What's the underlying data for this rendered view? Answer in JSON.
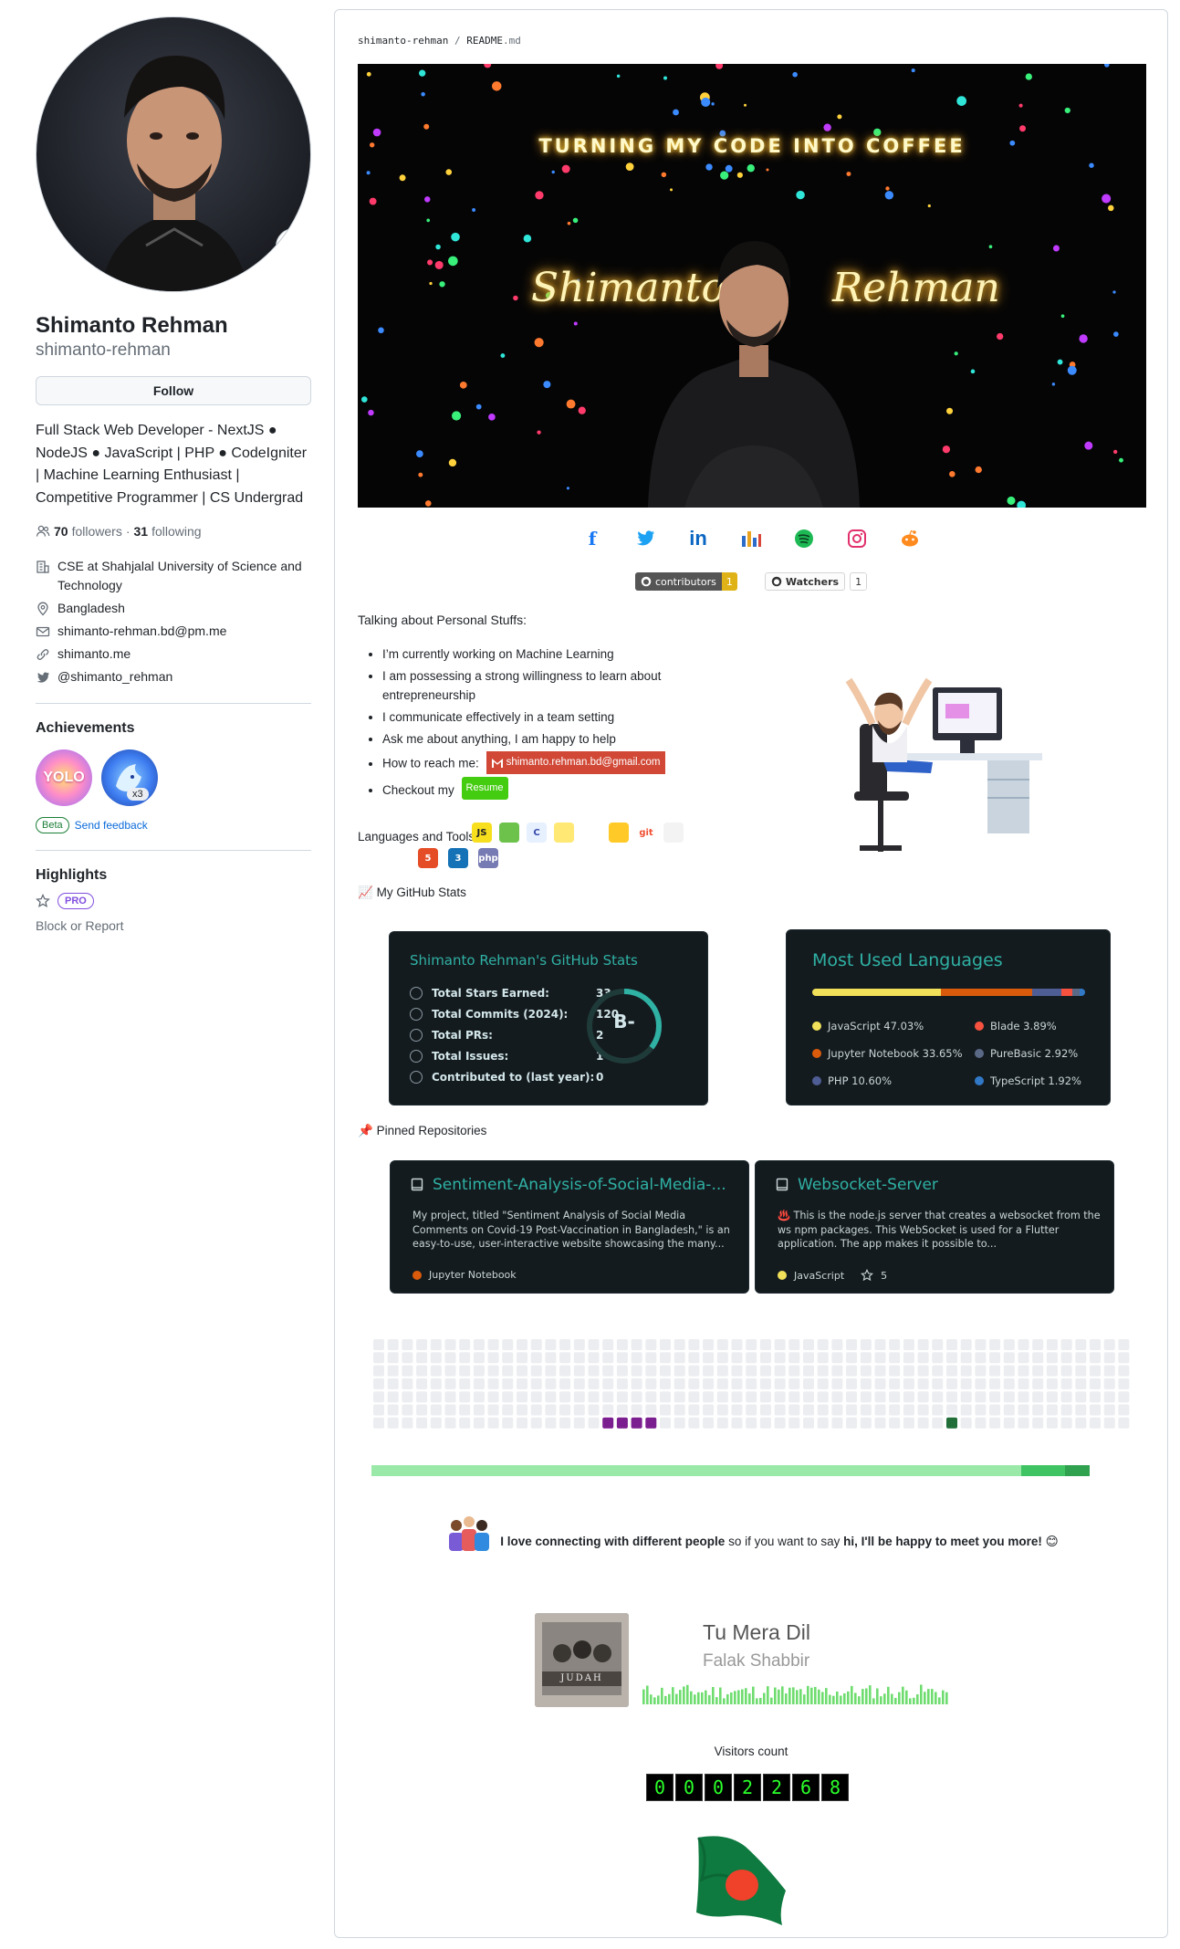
{
  "profile": {
    "display_name": "Shimanto Rehman",
    "login": "shimanto-rehman",
    "follow_label": "Follow",
    "bio": "Full Stack Web Developer - NextJS ● NodeJS ● JavaScript | PHP ● CodeIgniter | Machine Learning Enthusiast | Competitive Programmer | CS Undergrad",
    "followers_count": "70",
    "followers_label": "followers",
    "separator": "·",
    "following_count": "31",
    "following_label": "following",
    "org": "CSE at Shahjalal University of Science and Technology",
    "location": "Bangladesh",
    "email": "shimanto-rehman.bd@pm.me",
    "website": "shimanto.me",
    "twitter": "@shimanto_rehman"
  },
  "achievements": {
    "title": "Achievements",
    "badge_1": "YOLO",
    "badge_2_count": "x3",
    "beta_label": "Beta",
    "feedback_label": "Send feedback"
  },
  "highlights": {
    "title": "Highlights",
    "pro_label": "PRO",
    "block_label": "Block or Report"
  },
  "readme": {
    "path_owner": "shimanto-rehman",
    "path_sep": "/",
    "path_file": "README",
    "path_ext": ".md",
    "banner_title": "TURNING MY CODE INTO COFFEE",
    "banner_first": "Shimanto",
    "banner_last": "Rehman",
    "socials": [
      "f",
      "t",
      "in",
      "db",
      "sp",
      "ig",
      "rd"
    ],
    "shield_contributors_label": "contributors",
    "shield_contributors_value": "1",
    "shield_watchers_label": "Watchers",
    "shield_watchers_value": "1",
    "talking_title": "Talking about Personal Stuffs:",
    "stuff": [
      "I’m currently working on Machine Learning",
      "I am possessing a strong willingness to learn about entrepreneurship",
      "I communicate effectively in a team setting",
      "Ask me about anything, I am happy to help"
    ],
    "reach_label": "How to reach me:",
    "reach_email": "shimanto.rehman.bd@gmail.com",
    "checkout_label": "Checkout my",
    "resume_label": "Resume",
    "langs_tools_label": "Languages and Tools:",
    "tools_row1": [
      "JS",
      "",
      "C",
      "",
      "",
      "",
      "git",
      ""
    ],
    "tools_row2": [
      "",
      "",
      "5",
      "3",
      "php",
      "",
      ""
    ],
    "github_stats_label": "My GitHub Stats",
    "pinned_label": "Pinned Repositories",
    "connect_text_a": "I love connecting with different people",
    "connect_text_b": "so if you want to say",
    "connect_text_c": "hi, I'll be happy to meet you more!",
    "connect_emoji": "😊",
    "visitors_label": "Visitors count",
    "visitor_digits": [
      "0",
      "0",
      "0",
      "2",
      "2",
      "6",
      "8"
    ]
  },
  "stats_card": {
    "title": "Shimanto Rehman's GitHub Stats",
    "rank": "B-",
    "rows": [
      {
        "label": "Total Stars Earned:",
        "value": "33"
      },
      {
        "label": "Total Commits (2024):",
        "value": "120"
      },
      {
        "label": "Total PRs:",
        "value": "2"
      },
      {
        "label": "Total Issues:",
        "value": "1"
      },
      {
        "label": "Contributed to (last year):",
        "value": "0"
      }
    ]
  },
  "languages_card": {
    "title": "Most Used Languages",
    "items": [
      {
        "name": "JavaScript",
        "percent": "47.03%",
        "pct": 47.03,
        "color": "#f1e05a"
      },
      {
        "name": "Jupyter Notebook",
        "percent": "33.65%",
        "pct": 33.65,
        "color": "#da5b0b"
      },
      {
        "name": "PHP",
        "percent": "10.60%",
        "pct": 10.6,
        "color": "#4f5d95"
      },
      {
        "name": "Blade",
        "percent": "3.89%",
        "pct": 3.89,
        "color": "#f7523f"
      },
      {
        "name": "PureBasic",
        "percent": "2.92%",
        "pct": 2.92,
        "color": "#5a6986"
      },
      {
        "name": "TypeScript",
        "percent": "1.92%",
        "pct": 1.92,
        "color": "#3178c6"
      }
    ]
  },
  "repos": [
    {
      "name": "Sentiment-Analysis-of-Social-Media-...",
      "description": "My project, titled \"Sentiment Analysis of Social Media Comments on Covid-19 Post-Vaccination in Bangladesh,\" is an easy-to-use, user-interactive website showcasing the many...",
      "language": "Jupyter Notebook",
      "language_color": "#da5b0b",
      "stars": ""
    },
    {
      "name": "Websocket-Server",
      "description": "♨️ This is the node.js server that creates a websocket from the ws npm packages. This WebSocket is used for a Flutter application. The app makes it possible to...",
      "language": "JavaScript",
      "language_color": "#f1e05a",
      "stars": "5"
    }
  ],
  "spotify": {
    "song": "Tu Mera Dil",
    "artist": "Falak Shabbir",
    "album_text": "JUDAH"
  },
  "colors": {
    "accent_teal": "#2fb1a4",
    "card_bg": "#141b1f",
    "link": "#0969da"
  }
}
